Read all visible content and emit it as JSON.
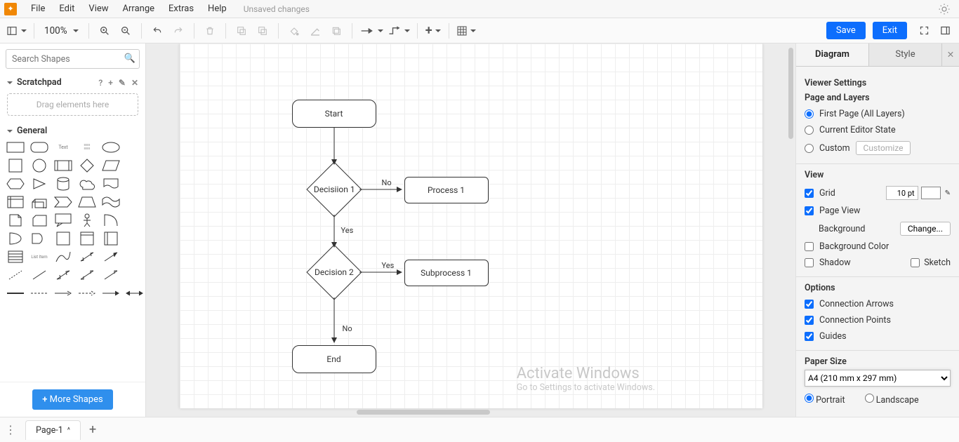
{
  "menu": {
    "file": "File",
    "edit": "Edit",
    "view": "View",
    "arrange": "Arrange",
    "extras": "Extras",
    "help": "Help",
    "status": "Unsaved changes"
  },
  "toolbar": {
    "zoom": "100%",
    "save": "Save",
    "exit": "Exit"
  },
  "sidebar": {
    "search_placeholder": "Search Shapes",
    "scratchpad": "Scratchpad",
    "dropzone": "Drag elements here",
    "general": "General",
    "more": "More Shapes"
  },
  "flow": {
    "start": "Start",
    "d1": "Decisiion 1",
    "d2": "Decision 2",
    "p1": "Process 1",
    "sp1": "Subprocess 1",
    "end": "End",
    "no": "No",
    "yes": "Yes"
  },
  "format": {
    "tab_diagram": "Diagram",
    "tab_style": "Style",
    "viewer": "Viewer Settings",
    "page_layers": "Page and Layers",
    "opt_first": "First Page (All Layers)",
    "opt_editor": "Current Editor State",
    "opt_custom": "Custom",
    "customize": "Customize",
    "view": "View",
    "grid": "Grid",
    "grid_val": "10 pt",
    "pageview": "Page View",
    "background": "Background",
    "change": "Change...",
    "bgcolor": "Background Color",
    "shadow": "Shadow",
    "sketch": "Sketch",
    "options": "Options",
    "conn_arrows": "Connection Arrows",
    "conn_points": "Connection Points",
    "guides": "Guides",
    "paper_size": "Paper Size",
    "paper_sel": "A4 (210 mm x 297 mm)",
    "portrait": "Portrait",
    "landscape": "Landscape"
  },
  "page": {
    "tab": "Page-1"
  },
  "watermark": {
    "t1": "Activate Windows",
    "t2": "Go to Settings to activate Windows."
  }
}
